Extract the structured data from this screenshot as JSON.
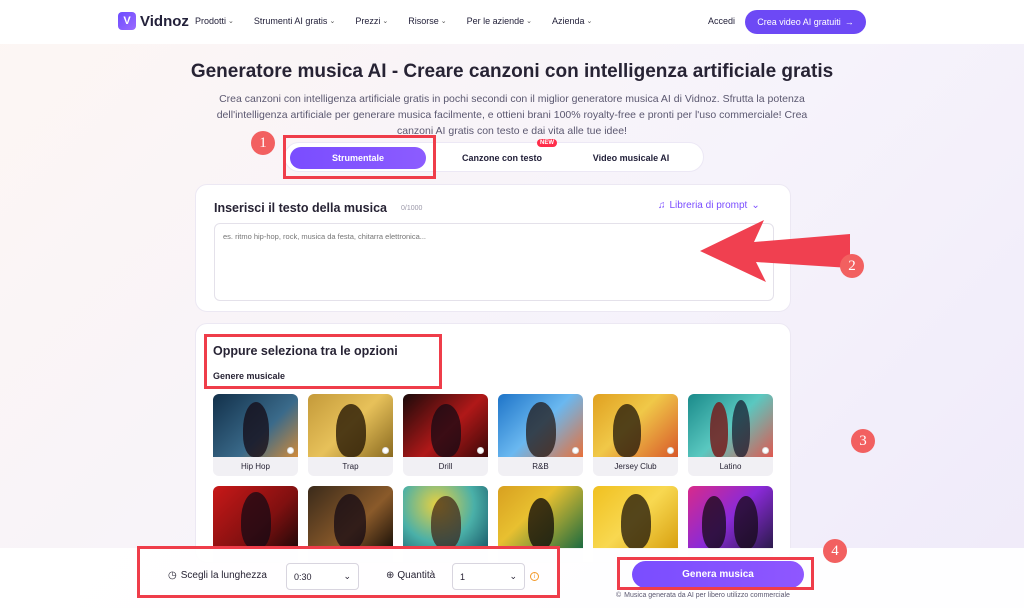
{
  "nav": {
    "logo": "Vidnoz",
    "menu": [
      "Prodotti",
      "Strumenti AI gratis",
      "Prezzi",
      "Risorse",
      "Per le aziende",
      "Azienda"
    ],
    "login": "Accedi",
    "cta": "Crea video AI gratuiti",
    "cta_icon": "arrow-right-icon"
  },
  "hero": {
    "title": "Generatore musica AI - Creare canzoni con intelligenza artificiale gratis",
    "subtitle": "Crea canzoni con intelligenza artificiale gratis in pochi secondi con il miglior generatore musica AI di Vidnoz. Sfrutta la potenza dell'intelligenza artificiale per generare musica facilmente, e ottieni brani 100% royalty-free e pronti per l'uso commerciale! Crea canzoni AI gratis con testo e dai vita alle tue idee!"
  },
  "tabs": {
    "items": [
      "Strumentale",
      "Canzone con testo",
      "Video musicale AI"
    ],
    "active": "Strumentale",
    "badge": "NEW"
  },
  "input": {
    "label": "Inserisci il testo della musica",
    "counter": "0/1000",
    "prompt_library": "Libreria di prompt",
    "placeholder": "es. ritmo hip-hop, rock, musica da festa, chitarra elettronica..."
  },
  "options": {
    "title": "Oppure seleziona tra le opzioni",
    "genre_label": "Genere musicale",
    "genres": [
      "Hip Hop",
      "Trap",
      "Drill",
      "R&B",
      "Jersey Club",
      "Latino"
    ]
  },
  "bottom": {
    "length_label": "Scegli la lunghezza",
    "length_value": "0:30",
    "quantity_label": "Quantità",
    "quantity_value": "1",
    "generate": "Genera musica",
    "note": "Musica generata da AI per libero utilizzo commerciale"
  },
  "annotations": {
    "numbers": [
      "1",
      "2",
      "3",
      "4"
    ],
    "color": "#ef3d4a"
  },
  "colors": {
    "accent": "#6d49f5",
    "text": "#272334"
  }
}
